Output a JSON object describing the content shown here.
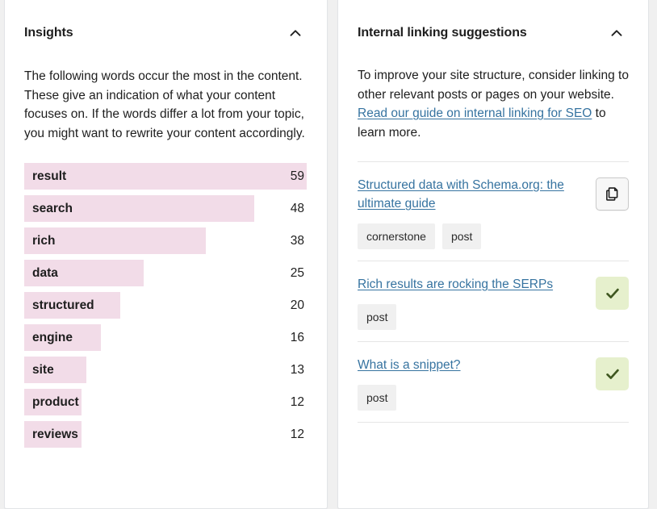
{
  "insights": {
    "title": "Insights",
    "collapse_icon": "chevron-up-icon",
    "intro": "The following words occur the most in the content. These give an indication of what your content focuses on. If the words differ a lot from your topic, you might want to rewrite your content accordingly.",
    "bar_color": "#f2dce8",
    "max_value": 59,
    "words": [
      {
        "word": "result",
        "count": 59
      },
      {
        "word": "search",
        "count": 48
      },
      {
        "word": "rich",
        "count": 38
      },
      {
        "word": "data",
        "count": 25
      },
      {
        "word": "structured",
        "count": 20
      },
      {
        "word": "engine",
        "count": 16
      },
      {
        "word": "site",
        "count": 13
      },
      {
        "word": "product",
        "count": 12
      },
      {
        "word": "reviews",
        "count": 12
      }
    ]
  },
  "internal_linking": {
    "title": "Internal linking suggestions",
    "collapse_icon": "chevron-up-icon",
    "intro_part1": "To improve your site structure, consider linking to other relevant posts or pages on your website. ",
    "intro_link": "Read our guide on internal linking for SEO",
    "intro_part2": " to learn more.",
    "link_color": "#3673a0",
    "check_bg_color": "#e6f0cd",
    "suggestions": [
      {
        "title": "Structured data with Schema.org: the ultimate guide",
        "tags": [
          "cornerstone",
          "post"
        ],
        "action": "copy",
        "action_icon": "copy-icon"
      },
      {
        "title": "Rich results are rocking the SERPs",
        "tags": [
          "post"
        ],
        "action": "linked",
        "action_icon": "check-icon"
      },
      {
        "title": "What is a snippet?",
        "tags": [
          "post"
        ],
        "action": "linked",
        "action_icon": "check-icon"
      }
    ]
  }
}
